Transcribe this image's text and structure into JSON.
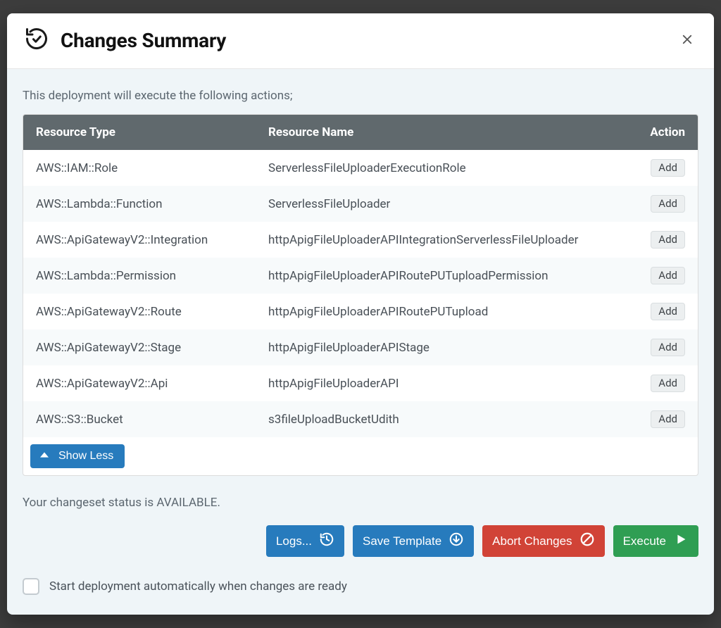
{
  "dialog": {
    "title": "Changes Summary",
    "intro": "This deployment will execute the following actions;",
    "columns": {
      "type": "Resource Type",
      "name": "Resource Name",
      "action": "Action"
    },
    "rows": [
      {
        "type": "AWS::IAM::Role",
        "name": "ServerlessFileUploaderExecutionRole",
        "action": "Add"
      },
      {
        "type": "AWS::Lambda::Function",
        "name": "ServerlessFileUploader",
        "action": "Add"
      },
      {
        "type": "AWS::ApiGatewayV2::Integration",
        "name": "httpApigFileUploaderAPIIntegrationServerlessFileUploader",
        "action": "Add"
      },
      {
        "type": "AWS::Lambda::Permission",
        "name": "httpApigFileUploaderAPIRoutePUTuploadPermission",
        "action": "Add"
      },
      {
        "type": "AWS::ApiGatewayV2::Route",
        "name": "httpApigFileUploaderAPIRoutePUTupload",
        "action": "Add"
      },
      {
        "type": "AWS::ApiGatewayV2::Stage",
        "name": "httpApigFileUploaderAPIStage",
        "action": "Add"
      },
      {
        "type": "AWS::ApiGatewayV2::Api",
        "name": "httpApigFileUploaderAPI",
        "action": "Add"
      },
      {
        "type": "AWS::S3::Bucket",
        "name": "s3fileUploadBucketUdith",
        "action": "Add"
      }
    ],
    "show_less_label": "Show Less",
    "status_text": "Your changeset status is AVAILABLE.",
    "buttons": {
      "logs": "Logs...",
      "save_template": "Save Template",
      "abort": "Abort Changes",
      "execute": "Execute"
    },
    "auto_checkbox_label": "Start deployment automatically when changes are ready",
    "auto_checkbox_checked": false
  }
}
